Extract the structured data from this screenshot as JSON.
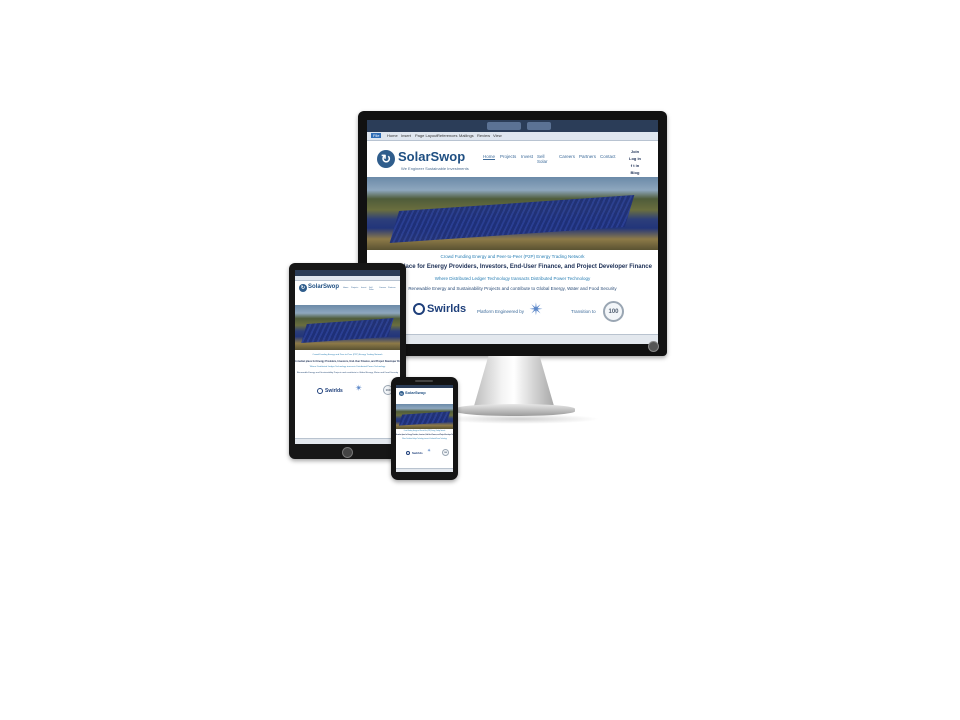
{
  "site": {
    "brand": "SolarSwop",
    "tagline": "We Engineer Sustainable Investments",
    "nav": [
      "Home",
      "Projects",
      "Invest",
      "Sell Solar",
      "Careers",
      "Partners",
      "Contact"
    ],
    "account": [
      "Join",
      "Log in",
      "f  t  in",
      "Blog"
    ],
    "line1": "Crowd Funding Energy and Peer-to-Peer (P2P) Energy Trading Network",
    "line2": "A market place for Energy Providers, Investors, End-User Finance, and Project Developer Finance",
    "line3": "Where Distributed Ledger Technology transacts Distributed Power Technology",
    "line4": "Renewable Energy and Sustainability Projects and contribute to Global Energy, Water and Food Security",
    "swirlds": "Swirlds",
    "engineered": "Platform Engineered by",
    "transition": "Transition to",
    "badge": "100"
  },
  "browser": {
    "menu": [
      "File",
      "Home",
      "Insert",
      "Page Layout",
      "References",
      "Mailings",
      "Review",
      "View"
    ]
  },
  "icons": {
    "logo": "refresh-arrows-icon",
    "partner": "star-compass-icon",
    "transition": "100-badge-icon"
  },
  "colors": {
    "brand": "#1f4f82",
    "link": "#3d6b9a",
    "teal": "#2a7fb4"
  }
}
